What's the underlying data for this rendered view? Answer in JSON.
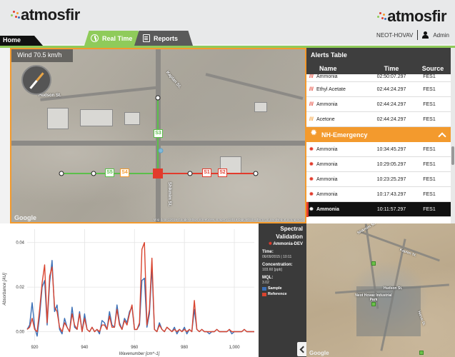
{
  "header": {
    "logo_text": "atmosfir",
    "user_org": "NEOT-HOVAV",
    "user_name": "Admin"
  },
  "tabs": {
    "home": "Home",
    "realtime": "Real Time",
    "reports": "Reports"
  },
  "map": {
    "wind_label": "Wind 70.5 km/h",
    "labels": {
      "street_1": "Hudson St.",
      "street_2": "Kaplan St.",
      "street_3": "Shikmim St.",
      "street_4": "Haruv St."
    },
    "sensors": [
      "S1",
      "S2",
      "S3",
      "S4",
      "S5"
    ],
    "footer": "Map data ©2015 Google, Maps StreetView Imagery ©2015 DigitalGlobe   Terms of Use   Report a map error",
    "google": "Google"
  },
  "alerts": {
    "title": "Alerts Table",
    "columns": {
      "name": "Name",
      "time": "Time",
      "source": "Source"
    },
    "rows_top": [
      {
        "name": "Ammonia",
        "time": "02:50:07.297",
        "source": "FES1"
      },
      {
        "name": "Ethyl Acetate",
        "time": "02:44:24.297",
        "source": "FES1"
      },
      {
        "name": "Ammonia",
        "time": "02:44:24.297",
        "source": "FES1"
      },
      {
        "name": "Acetone",
        "time": "02:44:24.297",
        "source": "FES1"
      }
    ],
    "group_label": "NH-Emergency",
    "rows_group": [
      {
        "name": "Ammonia",
        "time": "10:34:45.297",
        "source": "FES1"
      },
      {
        "name": "Ammonia",
        "time": "10:29:05.297",
        "source": "FES1"
      },
      {
        "name": "Ammonia",
        "time": "10:23:25.297",
        "source": "FES1"
      },
      {
        "name": "Ammonia",
        "time": "10:17:43.297",
        "source": "FES1"
      },
      {
        "name": "Ammonia",
        "time": "10:11:57.297",
        "source": "FES1"
      }
    ]
  },
  "validation": {
    "title_1": "Spectral",
    "title_2": "Validation",
    "gas": "Ammonia-DEV",
    "time_key": "Time:",
    "time_val": "06/09/2015 | 10:11",
    "conc_key": "Concentration:",
    "conc_val": "103.60 [ppb]",
    "mql_key": "MQL:",
    "mql_val": "3.02",
    "legend_sample": "Sample",
    "legend_reference": "Reference"
  },
  "minimap": {
    "labels": [
      "Shikmim St.",
      "Kaplan St.",
      "Hudson St.",
      "Neot Hovav Industrial Park",
      "Haruv St."
    ],
    "google": "Google"
  },
  "chart_data": {
    "type": "line",
    "xlabel": "Wavenumber [cm^-1]",
    "ylabel": "Absorbance [AU]",
    "xlim": [
      917,
      1008
    ],
    "ylim": [
      -0.004,
      0.046
    ],
    "xticks": [
      920,
      940,
      960,
      980,
      1000
    ],
    "xtick_labels": [
      "920",
      "940",
      "960",
      "980",
      "1,000"
    ],
    "yticks": [
      0.0,
      0.02,
      0.04
    ],
    "ytick_labels": [
      "0.00",
      "0.02",
      "0.04"
    ],
    "grid": true,
    "colors": {
      "sample": "#3b6fb6",
      "reference": "#d9442f"
    },
    "series": [
      {
        "name": "Sample",
        "x": [
          917,
          918,
          919,
          920,
          921,
          922,
          923,
          924,
          925,
          926,
          927,
          928,
          929,
          930,
          931,
          932,
          933,
          934,
          935,
          936,
          937,
          938,
          939,
          940,
          941,
          942,
          943,
          944,
          945,
          946,
          947,
          948,
          949,
          950,
          951,
          952,
          953,
          954,
          955,
          956,
          957,
          958,
          959,
          960,
          961,
          962,
          963,
          964,
          965,
          966,
          967,
          968,
          969,
          970,
          971,
          972,
          973,
          974,
          975,
          976,
          977,
          978,
          979,
          980,
          981,
          982,
          983,
          984,
          985,
          986,
          987,
          988,
          989,
          990,
          991,
          992,
          993,
          994,
          995,
          996,
          997,
          998,
          999,
          1000,
          1001,
          1002,
          1003,
          1004,
          1005,
          1006,
          1007,
          1008
        ],
        "y": [
          0.001,
          0.003,
          0.013,
          0.002,
          -0.002,
          0.007,
          0.02,
          0.023,
          0.003,
          0.022,
          0.032,
          0.009,
          0.012,
          0.001,
          -0.001,
          0.006,
          0.002,
          0.0,
          0.011,
          0.002,
          0.001,
          0.009,
          0.0,
          0.008,
          0.001,
          0.0,
          0.002,
          0.0,
          0.001,
          -0.001,
          0.005,
          0.004,
          0.001,
          0.009,
          0.003,
          0.002,
          0.012,
          0.004,
          0.001,
          0.006,
          0.004,
          0.009,
          0.011,
          0.001,
          0.001,
          0.003,
          0.023,
          0.024,
          0.002,
          0.008,
          0.029,
          0.001,
          0.0,
          0.004,
          0.001,
          0.0,
          0.002,
          0.001,
          0.0,
          0.002,
          -0.001,
          0.001,
          0.0,
          0.002,
          -0.001,
          0.001,
          0.0,
          0.01,
          0.001,
          0.0,
          0.001,
          0.0,
          0.0,
          -0.001,
          0.0,
          0.0,
          0.001,
          0.0,
          0.0,
          0.0,
          0.0,
          0.001,
          -0.001,
          0.0,
          0.0,
          0.0,
          0.0,
          0.001,
          0.0,
          0.0,
          0.0,
          0.0
        ]
      },
      {
        "name": "Reference",
        "x": [
          917,
          918,
          919,
          920,
          921,
          922,
          923,
          924,
          925,
          926,
          927,
          928,
          929,
          930,
          931,
          932,
          933,
          934,
          935,
          936,
          937,
          938,
          939,
          940,
          941,
          942,
          943,
          944,
          945,
          946,
          947,
          948,
          949,
          950,
          951,
          952,
          953,
          954,
          955,
          956,
          957,
          958,
          959,
          960,
          961,
          962,
          963,
          964,
          965,
          966,
          967,
          968,
          969,
          970,
          971,
          972,
          973,
          974,
          975,
          976,
          977,
          978,
          979,
          980,
          981,
          982,
          983,
          984,
          985,
          986,
          987,
          988,
          989,
          990,
          991,
          992,
          993,
          994,
          995,
          996,
          997,
          998,
          999,
          1000,
          1001,
          1002,
          1003,
          1004,
          1005,
          1006,
          1007,
          1008
        ],
        "y": [
          0.001,
          0.002,
          0.006,
          0.001,
          0.0,
          0.01,
          0.022,
          0.03,
          0.004,
          0.025,
          0.029,
          0.011,
          0.009,
          0.002,
          0.0,
          0.004,
          0.002,
          0.0,
          0.008,
          0.003,
          0.001,
          0.008,
          0.0,
          0.006,
          0.001,
          0.0,
          0.002,
          0.0,
          0.001,
          0.0,
          0.003,
          0.003,
          0.001,
          0.007,
          0.002,
          0.002,
          0.01,
          0.003,
          0.001,
          0.005,
          0.003,
          0.008,
          0.012,
          0.001,
          0.001,
          0.004,
          0.037,
          0.04,
          0.003,
          0.01,
          0.033,
          0.001,
          0.0,
          0.003,
          0.001,
          0.0,
          0.002,
          0.001,
          0.0,
          0.001,
          0.0,
          0.001,
          0.0,
          0.001,
          0.0,
          0.001,
          0.0,
          0.014,
          0.001,
          0.0,
          0.001,
          0.0,
          0.0,
          0.0,
          0.0,
          0.0,
          0.001,
          0.0,
          0.0,
          0.0,
          0.0,
          0.001,
          0.0,
          0.0,
          0.0,
          0.0,
          0.0,
          0.001,
          0.0,
          0.0,
          0.0,
          0.0
        ]
      }
    ]
  }
}
